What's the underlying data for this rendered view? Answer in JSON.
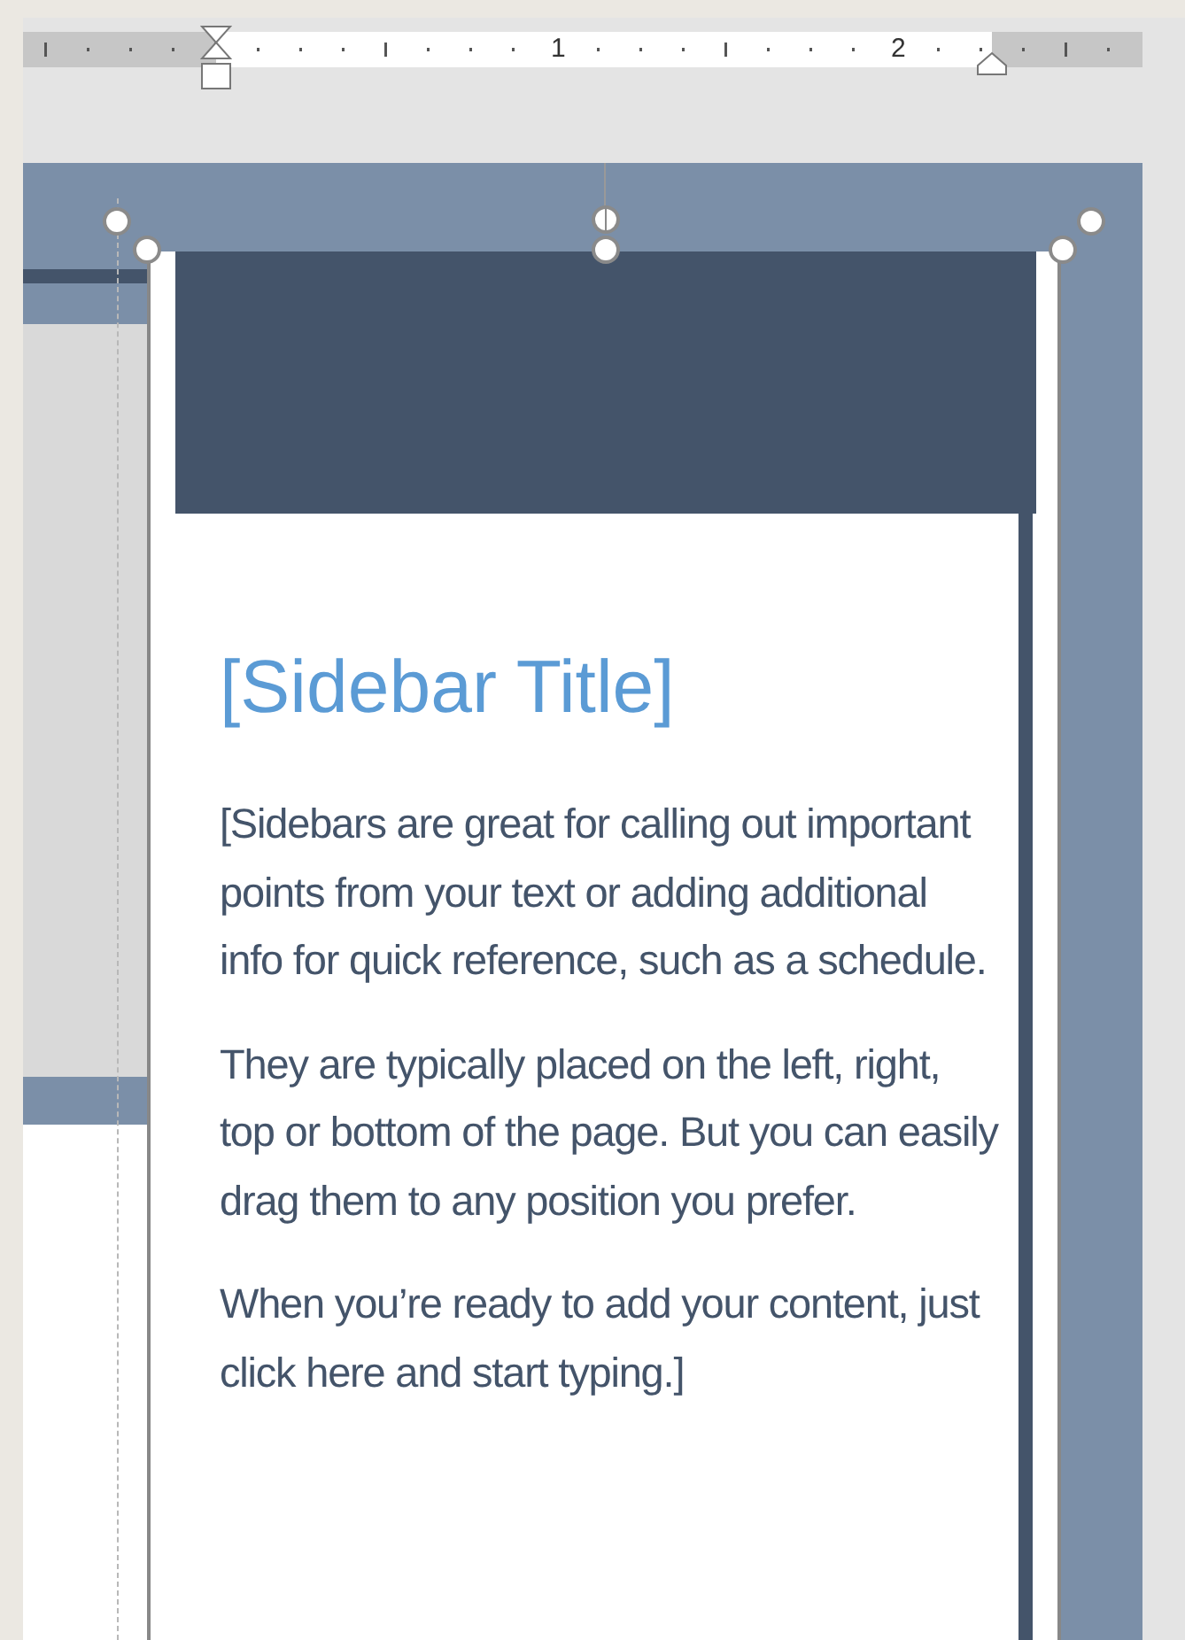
{
  "ruler": {
    "labels": [
      "1",
      "2"
    ]
  },
  "sidebar": {
    "title": "[Sidebar Title]",
    "paragraphs": [
      "[Sidebars are great for calling out important points from your text or adding additional info for quick reference, such as a schedule.",
      "They are typically placed on the left, right, top or bottom of the page. But you can easily drag them to any position you prefer.",
      "When you’re ready to add your content, just click here and start typing.]"
    ]
  }
}
